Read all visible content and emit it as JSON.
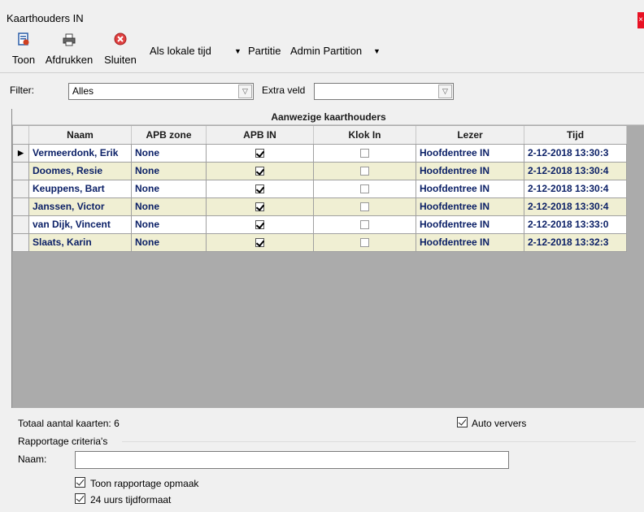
{
  "window": {
    "title": "Kaarthouders IN",
    "close_symbol": "×"
  },
  "toolbar": {
    "show_label": "Toon",
    "print_label": "Afdrukken",
    "close_label": "Sluiten",
    "time_mode": "Als lokale tijd",
    "partition_label": "Partitie",
    "partition_value": "Admin Partition",
    "icons": {
      "show": "show-report-icon",
      "print": "printer-icon",
      "close": "close-circle-icon"
    }
  },
  "filter": {
    "label": "Filter:",
    "value": "Alles",
    "extra_label": "Extra veld",
    "extra_value": ""
  },
  "grid": {
    "title": "Aanwezige kaarthouders",
    "columns": [
      "Naam",
      "APB zone",
      "APB IN",
      "Klok In",
      "Lezer",
      "Tijd"
    ],
    "rows": [
      {
        "naam": "Vermeerdonk, Erik",
        "zone": "None",
        "apb_in": true,
        "klok_in": false,
        "lezer": "Hoofdentree IN",
        "tijd": "2-12-2018 13:30:3"
      },
      {
        "naam": "Doomes, Resie",
        "zone": "None",
        "apb_in": true,
        "klok_in": false,
        "lezer": "Hoofdentree IN",
        "tijd": "2-12-2018 13:30:4"
      },
      {
        "naam": "Keuppens, Bart",
        "zone": "None",
        "apb_in": true,
        "klok_in": false,
        "lezer": "Hoofdentree IN",
        "tijd": "2-12-2018 13:30:4"
      },
      {
        "naam": "Janssen, Victor",
        "zone": "None",
        "apb_in": true,
        "klok_in": false,
        "lezer": "Hoofdentree IN",
        "tijd": "2-12-2018 13:30:4"
      },
      {
        "naam": "van Dijk, Vincent",
        "zone": "None",
        "apb_in": true,
        "klok_in": false,
        "lezer": "Hoofdentree IN",
        "tijd": "2-12-2018 13:33:0"
      },
      {
        "naam": "Slaats, Karin",
        "zone": "None",
        "apb_in": true,
        "klok_in": false,
        "lezer": "Hoofdentree IN",
        "tijd": "2-12-2018 13:32:3"
      }
    ],
    "current_row_marker": "▶"
  },
  "footer": {
    "total_label": "Totaal aantal kaarten: 6",
    "auto_refresh_label": "Auto ververs",
    "auto_refresh_checked": true,
    "criteria_label": "Rapportage criteria's",
    "name_label": "Naam:",
    "name_value": "",
    "show_layout_label": "Toon rapportage opmaak",
    "show_layout_checked": true,
    "time_format_label": "24 uurs tijdformaat",
    "time_format_checked": true
  },
  "colors": {
    "row_alt": "#f0efd3",
    "row_text": "#0a1f66",
    "close_red": "#e81123",
    "grid_empty": "#ababab"
  }
}
